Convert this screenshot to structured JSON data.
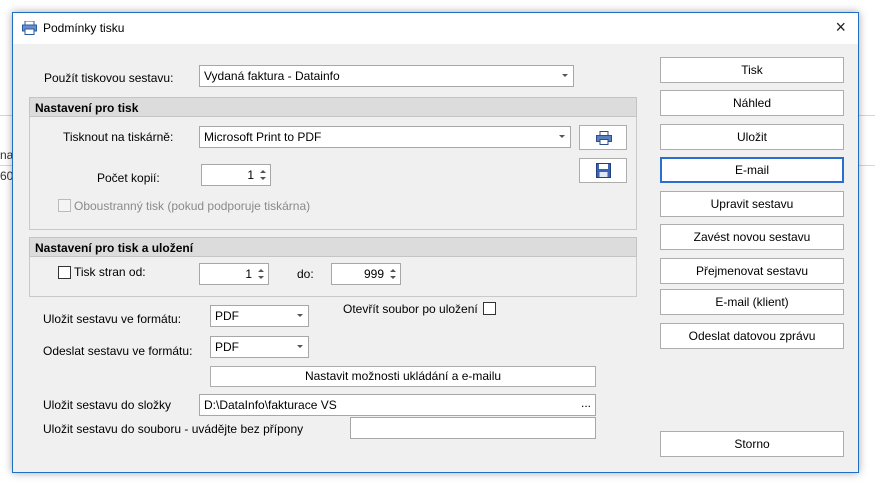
{
  "background": {
    "frag1": "na",
    "frag2": "60"
  },
  "dialog": {
    "title": "Podmínky tisku",
    "close_icon": "×"
  },
  "form": {
    "report_label": "Použít tiskovou sestavu:",
    "report_value": "Vydaná faktura - Datainfo",
    "print_section_title": "Nastavení pro tisk",
    "printer_label": "Tisknout na tiskárně:",
    "printer_value": "Microsoft Print to PDF",
    "copies_label": "Počet kopií:",
    "copies_value": "1",
    "duplex_label": "Oboustranný tisk (pokud podporuje tiskárna)",
    "print_save_section_title": "Nastavení pro tisk a uložení",
    "pages_from_label": "Tisk stran od:",
    "pages_from_value": "1",
    "pages_to_label": "do:",
    "pages_to_value": "999",
    "save_format_label": "Uložit sestavu ve formátu:",
    "save_format_value": "PDF",
    "open_after_save_label": "Otevřít soubor po uložení",
    "send_format_label": "Odeslat sestavu ve formátu:",
    "send_format_value": "PDF",
    "settings_button": "Nastavit možnosti ukládání a e-mailu",
    "folder_label": "Uložit sestavu do složky",
    "folder_value": "D:\\DataInfo\\fakturace VS",
    "folder_browse": "...",
    "file_label": "Uložit sestavu do souboru - uvádějte bez přípony",
    "file_value": ""
  },
  "buttons": {
    "print": "Tisk",
    "preview": "Náhled",
    "save": "Uložit",
    "email": "E-mail",
    "edit_report": "Upravit sestavu",
    "new_report": "Zavést novou sestavu",
    "rename_report": "Přejmenovat sestavu",
    "email_client": "E-mail (klient)",
    "send_data_message": "Odeslat datovou zprávu",
    "cancel": "Storno"
  },
  "icons": {
    "app": "printer-icon",
    "printer_setup": "printer-icon",
    "save_disk": "floppy-disk-icon"
  },
  "colors": {
    "accent": "#2a6fcf",
    "dialog_bg": "#f0f0f0",
    "group_header": "#dcdcdc"
  }
}
